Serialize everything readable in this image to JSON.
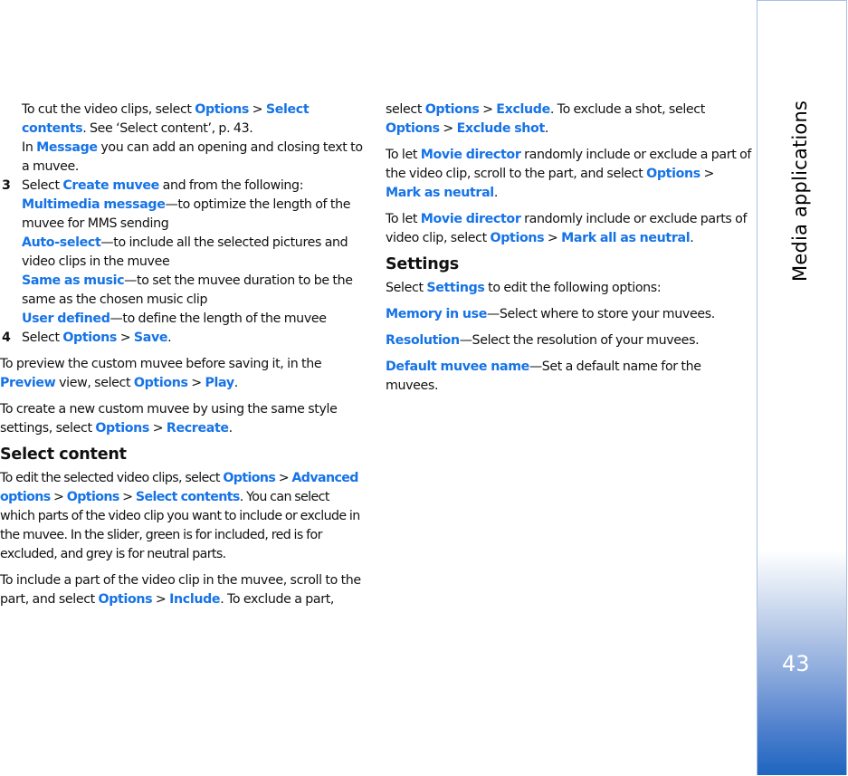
{
  "sidebar": {
    "section_title": "Media applications",
    "page_number": "43",
    "colors": {
      "gradient_bottom": "#1e65bf",
      "border": "#a9bfe3"
    }
  },
  "colors": {
    "link": "#1673e6",
    "text": "#111111"
  },
  "left_column": {
    "p1": {
      "t1": "To cut the video clips, select ",
      "l1": "Options",
      "t2": " > ",
      "l2": "Select contents",
      "t3": ". See ‘Select content’, p. 43."
    },
    "p2": {
      "t1": "In ",
      "l1": "Message",
      "t2": " you can add an opening and closing text to a muvee."
    },
    "step3": {
      "num": "3",
      "t1": "Select ",
      "l1": "Create muvee",
      "t2": " and from the following:",
      "options": [
        {
          "label": "Multimedia message",
          "desc": "—to optimize the length of the muvee for MMS sending"
        },
        {
          "label": "Auto-select",
          "desc": "—to include all the selected pictures and video clips in the muvee"
        },
        {
          "label": "Same as music",
          "desc": "—to set the muvee duration to be the same as the chosen music clip"
        },
        {
          "label": "User defined",
          "desc": "—to define the length of the muvee"
        }
      ]
    },
    "step4": {
      "num": "4",
      "t1": "Select ",
      "l1": "Options",
      "t2": " > ",
      "l2": "Save",
      "t3": "."
    },
    "p_preview": {
      "t1": "To preview the custom muvee before saving it, in the ",
      "l1": "Preview",
      "t2": " view, select ",
      "l2": "Options",
      "t3": " > ",
      "l3": "Play",
      "t4": "."
    },
    "p_recreate": {
      "t1": "To create a new custom muvee by using the same style settings, select ",
      "l1": "Options",
      "t2": " > ",
      "l2": "Recreate",
      "t3": "."
    },
    "heading_select_content": "Select content",
    "p_edit": {
      "t1": "To edit the selected video clips, select ",
      "l1": "Options",
      "t2": " > ",
      "l2": "Advanced options",
      "t3": " > ",
      "l3": "Options",
      "t4": " > ",
      "l4": "Select contents",
      "t5": ". You can select which parts of the video clip you want to include or exclude in the muvee. In the slider, green is for included, red is for excluded, and grey is for neutral parts."
    },
    "p_include": {
      "t1": "To include a part of the video clip in the muvee, scroll to the part, and select ",
      "l1": "Options",
      "t2": " > ",
      "l2": "Include",
      "t3": ". To exclude a part,"
    }
  },
  "right_column": {
    "p_exclude": {
      "t1": "select ",
      "l1": "Options",
      "t2": " > ",
      "l2": "Exclude",
      "t3": ". To exclude a shot, select ",
      "l3": "Options",
      "t4": " > ",
      "l4": "Exclude shot",
      "t5": "."
    },
    "p_neutral": {
      "t1": "To let ",
      "l1": "Movie director",
      "t2": " randomly include or exclude a part of the video clip, scroll to the part, and select ",
      "l2": "Options",
      "t3": " > ",
      "l3": "Mark as neutral",
      "t4": "."
    },
    "p_all_neutral": {
      "t1": "To let ",
      "l1": "Movie director",
      "t2": " randomly include or exclude parts of video clip, select ",
      "l2": "Options",
      "t3": " > ",
      "l3": "Mark all as neutral",
      "t4": "."
    },
    "heading_settings": "Settings",
    "p_settings": {
      "t1": "Select ",
      "l1": "Settings",
      "t2": " to edit the following options:"
    },
    "settings_items": [
      {
        "label": "Memory in use",
        "desc": "—Select where to store your muvees."
      },
      {
        "label": "Resolution",
        "desc": "—Select the resolution of your muvees."
      },
      {
        "label": "Default muvee name",
        "desc": "—Set a default name for the muvees."
      }
    ]
  }
}
